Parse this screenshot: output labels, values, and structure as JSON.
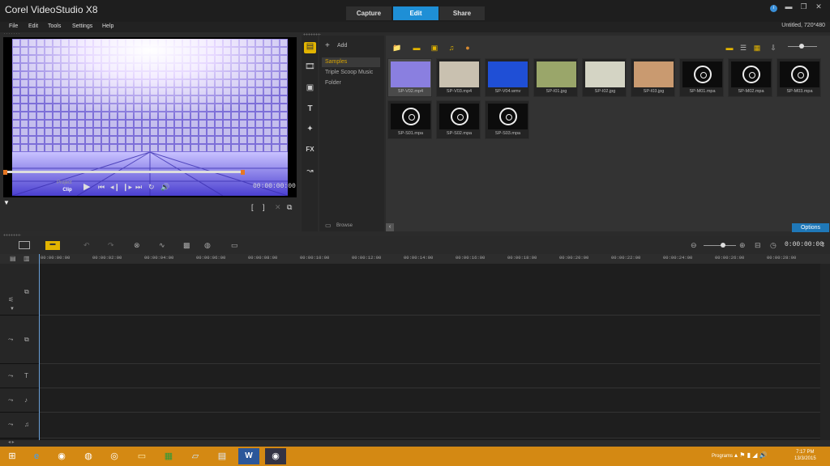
{
  "app": {
    "title": "Corel VideoStudio X8",
    "project_info": "Untitled, 720*480"
  },
  "mode_tabs": [
    {
      "label": "Capture"
    },
    {
      "label": "Edit",
      "active": true
    },
    {
      "label": "Share"
    }
  ],
  "menu": [
    "File",
    "Edit",
    "Tools",
    "Settings",
    "Help"
  ],
  "preview": {
    "project_label": "Project",
    "clip_label": "Clip",
    "timecode": "00:00:00:00"
  },
  "library": {
    "add_label": "Add",
    "browse_label": "Browse",
    "options_label": "Options",
    "nav_items": [
      "Samples",
      "Triple Scoop Music",
      "Folder"
    ],
    "media": [
      {
        "name": "SP-V02.mp4",
        "kind": "video",
        "color": "#8a7fe0"
      },
      {
        "name": "SP-V03.mp4",
        "kind": "video",
        "color": "#c9c1b0"
      },
      {
        "name": "SP-V04.wmv",
        "kind": "video",
        "color": "#1f4fd6"
      },
      {
        "name": "SP-I01.jpg",
        "kind": "image",
        "color": "#9aa66a"
      },
      {
        "name": "SP-I02.jpg",
        "kind": "image",
        "color": "#d4d4c4"
      },
      {
        "name": "SP-I03.jpg",
        "kind": "image",
        "color": "#c99a70"
      },
      {
        "name": "SP-M01.mpa",
        "kind": "audio"
      },
      {
        "name": "SP-M02.mpa",
        "kind": "audio"
      },
      {
        "name": "SP-M03.mpa",
        "kind": "audio"
      },
      {
        "name": "SP-S01.mpa",
        "kind": "audio"
      },
      {
        "name": "SP-S02.mpa",
        "kind": "audio"
      },
      {
        "name": "SP-S03.mpa",
        "kind": "audio"
      }
    ]
  },
  "timeline": {
    "timecode": "0:00:00:00",
    "ruler": [
      "00:00:00:00",
      "00:00:02:00",
      "00:00:04:00",
      "00:00:06:00",
      "00:00:08:00",
      "00:00:10:00",
      "00:00:12:00",
      "00:00:14:00",
      "00:00:16:00",
      "00:00:18:00",
      "00:00:20:00",
      "00:00:22:00",
      "00:00:24:00",
      "00:00:26:00",
      "00:00:28:00"
    ]
  },
  "taskbar": {
    "programs_label": "Programs",
    "time": "7:17 PM",
    "date": "13/3/2015"
  }
}
